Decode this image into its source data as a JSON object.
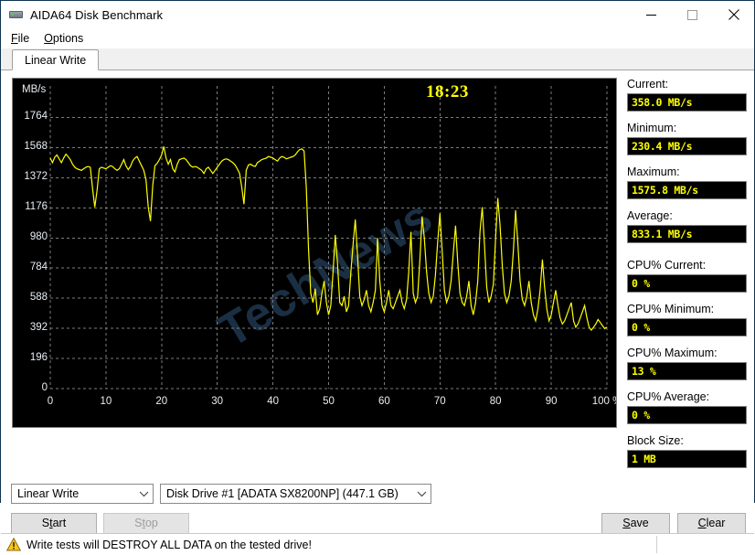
{
  "window": {
    "title": "AIDA64 Disk Benchmark",
    "icon": "disk-drive-icon",
    "minimize": "minimize-icon",
    "maximize": "maximize-icon",
    "close": "close-icon"
  },
  "menu": {
    "items": [
      {
        "label": "File",
        "accel": "F"
      },
      {
        "label": "Options",
        "accel": "O"
      }
    ]
  },
  "tabs": [
    {
      "label": "Linear Write",
      "active": true
    }
  ],
  "chart_data": {
    "type": "line",
    "title": "",
    "xlabel": "%",
    "ylabel": "MB/s",
    "timer": "18:23",
    "line_color": "#ffff00",
    "background": "#000000",
    "grid": true,
    "grid_color": "#7d7d7d",
    "xlim": [
      0,
      100
    ],
    "ylim": [
      0,
      1862
    ],
    "yticks": [
      0,
      196,
      392,
      588,
      784,
      980,
      1176,
      1372,
      1568,
      1764
    ],
    "xticks": [
      0,
      10,
      20,
      30,
      40,
      50,
      60,
      70,
      80,
      90,
      100
    ],
    "xtick_labels": [
      "0",
      "10",
      "20",
      "30",
      "40",
      "50",
      "60",
      "70",
      "80",
      "90",
      "100 %"
    ],
    "watermark": "TechNews",
    "series": [
      {
        "name": "Linear Write",
        "x": [
          0,
          0.4,
          0.8,
          1.2,
          1.6,
          2,
          2.4,
          2.8,
          3.2,
          3.6,
          4,
          4.4,
          4.8,
          5.2,
          5.6,
          6,
          6.4,
          6.8,
          7.2,
          7.6,
          8,
          8.4,
          8.8,
          9.2,
          9.6,
          10,
          10.4,
          10.8,
          11.2,
          11.6,
          12,
          12.4,
          12.8,
          13.2,
          13.6,
          14,
          14.4,
          14.8,
          15.2,
          15.6,
          16,
          16.4,
          16.8,
          17.2,
          17.6,
          18,
          18.4,
          18.8,
          19.2,
          19.6,
          20,
          20.4,
          20.8,
          21.2,
          21.6,
          22,
          22.4,
          22.8,
          23.2,
          23.6,
          24,
          24.4,
          24.8,
          25.2,
          25.6,
          26,
          26.4,
          26.8,
          27.2,
          27.6,
          28,
          28.4,
          28.8,
          29.2,
          29.6,
          30,
          30.4,
          30.8,
          31.2,
          31.6,
          32,
          32.4,
          32.8,
          33.2,
          33.6,
          34,
          34.4,
          34.8,
          35.2,
          35.6,
          36,
          36.4,
          36.8,
          37,
          37.2,
          37.6,
          38,
          38.4,
          38.8,
          39.2,
          39.6,
          40,
          40.4,
          40.8,
          41.2,
          41.6,
          42,
          42.4,
          42.8,
          43.2,
          43.6,
          44,
          44.4,
          44.8,
          45.2,
          45.6,
          46,
          46.4,
          46.8,
          47.2,
          47.6,
          48,
          48.4,
          48.8,
          49.2,
          49.6,
          50,
          50.4,
          50.8,
          51.2,
          51.6,
          52,
          52.4,
          52.8,
          53.2,
          53.6,
          54,
          54.4,
          54.8,
          55.2,
          55.6,
          56,
          56.4,
          56.8,
          57.2,
          57.6,
          58,
          58.4,
          58.8,
          59.2,
          59.6,
          60,
          60.4,
          60.8,
          61.2,
          61.6,
          62,
          62.4,
          62.8,
          63.2,
          63.6,
          64,
          64.4,
          64.8,
          65.2,
          65.6,
          66,
          66.4,
          66.8,
          67.2,
          67.6,
          68,
          68.4,
          68.8,
          69.2,
          69.6,
          70,
          70.4,
          70.8,
          71.2,
          71.6,
          72,
          72.4,
          72.8,
          73.2,
          73.6,
          74,
          74.4,
          74.8,
          75.2,
          75.6,
          76,
          76.4,
          76.8,
          77.2,
          77.6,
          78,
          78.4,
          78.8,
          79.2,
          79.6,
          80,
          80.4,
          80.8,
          81.2,
          81.6,
          82,
          82.4,
          82.8,
          83.2,
          83.6,
          84,
          84.4,
          84.8,
          85.2,
          85.6,
          86,
          86.4,
          86.8,
          87.2,
          87.6,
          88,
          88.4,
          88.8,
          89.2,
          89.6,
          90,
          90.4,
          90.8,
          91.2,
          91.6,
          92,
          92.4,
          92.8,
          93.2,
          93.6,
          94,
          94.4,
          94.8,
          95.2,
          95.6,
          96,
          96.4,
          96.8,
          97.2,
          97.6,
          98,
          98.4,
          98.8,
          99.2,
          99.6,
          100
        ],
        "y": [
          1500,
          1470,
          1505,
          1520,
          1495,
          1470,
          1500,
          1525,
          1510,
          1490,
          1460,
          1440,
          1430,
          1425,
          1420,
          1430,
          1440,
          1445,
          1440,
          1300,
          1180,
          1290,
          1430,
          1440,
          1435,
          1430,
          1440,
          1450,
          1445,
          1430,
          1420,
          1430,
          1460,
          1490,
          1450,
          1425,
          1445,
          1480,
          1500,
          1510,
          1480,
          1450,
          1420,
          1360,
          1180,
          1090,
          1320,
          1450,
          1465,
          1490,
          1520,
          1575,
          1500,
          1460,
          1490,
          1430,
          1410,
          1460,
          1490,
          1495,
          1500,
          1490,
          1470,
          1450,
          1440,
          1445,
          1440,
          1430,
          1420,
          1400,
          1430,
          1440,
          1420,
          1400,
          1420,
          1440,
          1460,
          1480,
          1490,
          1495,
          1490,
          1480,
          1470,
          1455,
          1430,
          1400,
          1310,
          1200,
          1420,
          1455,
          1460,
          1450,
          1445,
          1455,
          1470,
          1480,
          1490,
          1495,
          1500,
          1510,
          1505,
          1500,
          1490,
          1480,
          1500,
          1510,
          1505,
          1495,
          1500,
          1505,
          1510,
          1520,
          1540,
          1555,
          1560,
          1545,
          1310,
          900,
          620,
          560,
          650,
          480,
          520,
          620,
          700,
          560,
          480,
          540,
          760,
          1000,
          820,
          560,
          540,
          600,
          500,
          540,
          760,
          940,
          1100,
          860,
          600,
          540,
          580,
          640,
          540,
          500,
          560,
          640,
          980,
          700,
          540,
          500,
          560,
          640,
          540,
          520,
          560,
          600,
          640,
          560,
          520,
          580,
          760,
          1020,
          620,
          560,
          600,
          840,
          1120,
          980,
          760,
          620,
          560,
          600,
          740,
          960,
          1140,
          900,
          640,
          560,
          600,
          700,
          880,
          1060,
          820,
          620,
          560,
          540,
          600,
          700,
          540,
          480,
          560,
          700,
          1020,
          1180,
          940,
          660,
          560,
          600,
          680,
          980,
          1240,
          1060,
          800,
          620,
          560,
          600,
          700,
          900,
          1160,
          940,
          700,
          580,
          540,
          600,
          700,
          560,
          480,
          440,
          520,
          640,
          840,
          660,
          520,
          440,
          480,
          560,
          640,
          540,
          460,
          420,
          440,
          480,
          520,
          560,
          440,
          400,
          420,
          460,
          500,
          540,
          460,
          400,
          380,
          400,
          420,
          450,
          430,
          410,
          390,
          400,
          420,
          440,
          400,
          380,
          370,
          380,
          400,
          420,
          450,
          480,
          520,
          440,
          400,
          390,
          400,
          420,
          400,
          380,
          370,
          380,
          400,
          420,
          400,
          390,
          380,
          400,
          420,
          440,
          400,
          380,
          390,
          400,
          420,
          440,
          470,
          500,
          440,
          400,
          380,
          390,
          400,
          420,
          390,
          370,
          380,
          400,
          420,
          440,
          400,
          380,
          390,
          400,
          420,
          450,
          480,
          520,
          560,
          600,
          640,
          560,
          480,
          420,
          400,
          380,
          400,
          420,
          440,
          400,
          380,
          390,
          400,
          420,
          450,
          430,
          400,
          380,
          390,
          400,
          420,
          440,
          390,
          370,
          380,
          400,
          420,
          440,
          400,
          380,
          370,
          380,
          400,
          420,
          440,
          460,
          490,
          520,
          440,
          400,
          380,
          390,
          400,
          420,
          400,
          380,
          370,
          380,
          400,
          420,
          400,
          380,
          390,
          400,
          420,
          400,
          380,
          370,
          380,
          400,
          420,
          450,
          480,
          510,
          440,
          400,
          380,
          390,
          400,
          420,
          390,
          370,
          380,
          400,
          420,
          440,
          400,
          380,
          390,
          400,
          420,
          440,
          400,
          380,
          370,
          380,
          400,
          420,
          400,
          380,
          390,
          400,
          420,
          440,
          390,
          370,
          380,
          400,
          420,
          440,
          400,
          380,
          390,
          400,
          420,
          400,
          380,
          370,
          380,
          400,
          420,
          440,
          460,
          420,
          400,
          380,
          390,
          400,
          420,
          390,
          370,
          380,
          400,
          420,
          440,
          400,
          380,
          390,
          400,
          420,
          400,
          380,
          370,
          380,
          400,
          420,
          450,
          480,
          510,
          540,
          580,
          620,
          660,
          600,
          540,
          480,
          440,
          400,
          380,
          390,
          400,
          420,
          400,
          380,
          370,
          380,
          400,
          420,
          440,
          400,
          380,
          390,
          400,
          420,
          400,
          380,
          370,
          380,
          400,
          420,
          450,
          480,
          520,
          560,
          600,
          640,
          580,
          520,
          460,
          420,
          400,
          380,
          390,
          400,
          420,
          400,
          380,
          370,
          380,
          400,
          420,
          440,
          400,
          380,
          390,
          400,
          420,
          400,
          380,
          400,
          420,
          440,
          400,
          380,
          390,
          400
        ]
      }
    ]
  },
  "stats": {
    "items": [
      {
        "label": "Current:",
        "value": "358.0 MB/s",
        "name": "current"
      },
      {
        "label": "Minimum:",
        "value": "230.4 MB/s",
        "name": "minimum"
      },
      {
        "label": "Maximum:",
        "value": "1575.8 MB/s",
        "name": "maximum"
      },
      {
        "label": "Average:",
        "value": "833.1 MB/s",
        "name": "average"
      },
      {
        "label": "CPU% Current:",
        "value": "0 %",
        "name": "cpu-current"
      },
      {
        "label": "CPU% Minimum:",
        "value": "0 %",
        "name": "cpu-minimum"
      },
      {
        "label": "CPU% Maximum:",
        "value": "13 %",
        "name": "cpu-maximum"
      },
      {
        "label": "CPU% Average:",
        "value": "0 %",
        "name": "cpu-average"
      },
      {
        "label": "Block Size:",
        "value": "1 MB",
        "name": "block-size"
      }
    ]
  },
  "controls": {
    "mode_combo": {
      "value": "Linear Write"
    },
    "drive_combo": {
      "value": "Disk Drive #1  [ADATA SX8200NP]  (447.1 GB)"
    },
    "start_button": {
      "label": "Start",
      "accel": "t",
      "enabled": true
    },
    "stop_button": {
      "label": "Stop",
      "accel": "t",
      "enabled": false
    },
    "save_button": {
      "label": "Save",
      "accel": "S",
      "enabled": true
    },
    "clear_button": {
      "label": "Clear",
      "accel": "C",
      "enabled": true
    }
  },
  "statusbar": {
    "icon": "warning-triangle-icon",
    "text": "Write tests will DESTROY ALL DATA on the tested drive!"
  },
  "colors": {
    "accent_yellow": "#ffff00",
    "chart_bg": "#000000",
    "grid": "#7d7d7d",
    "window_border": "#0f3450",
    "warning": "#f0c020"
  }
}
